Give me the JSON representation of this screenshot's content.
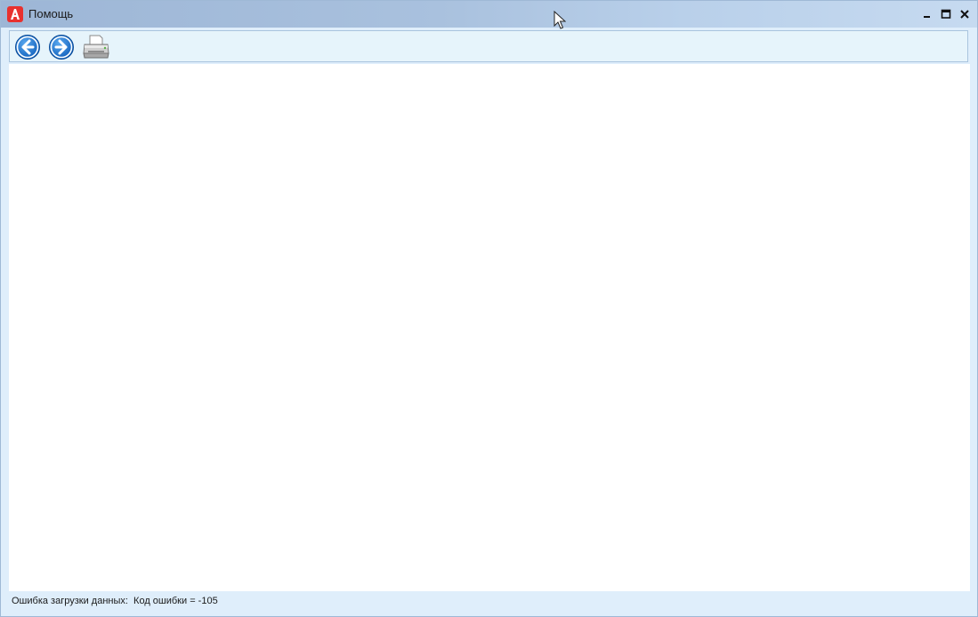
{
  "window": {
    "title": "Помощь",
    "app_icon": "app-logo-icon",
    "controls": [
      "minimize-icon",
      "maximize-icon",
      "close-icon"
    ]
  },
  "toolbar": {
    "buttons": [
      {
        "name": "back-button",
        "icon": "arrow-left-icon"
      },
      {
        "name": "forward-button",
        "icon": "arrow-right-icon"
      },
      {
        "name": "print-button",
        "icon": "printer-icon"
      }
    ]
  },
  "status": {
    "text": "Ошибка загрузки данных:  Код ошибки = -105"
  },
  "colors": {
    "accent_blue": "#1a72c9",
    "toolbar_bg": "#e6f4fb",
    "frame_bg": "#dfeefb"
  }
}
